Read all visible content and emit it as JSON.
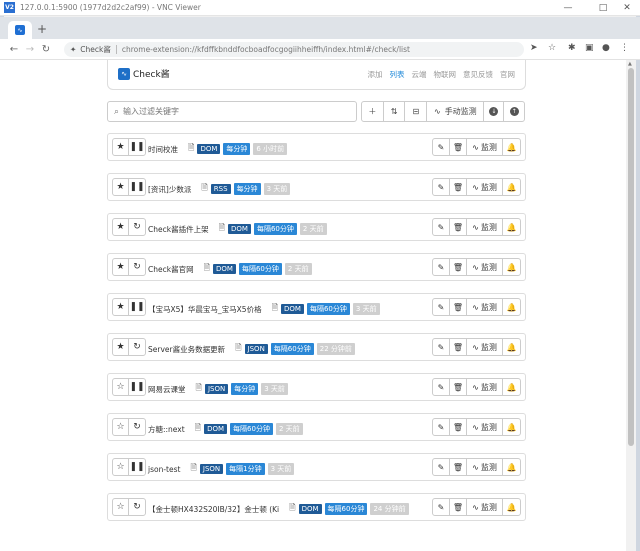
{
  "vnc": {
    "title": "127.0.0.1:5900 (1977d2d2c2af99) - VNC Viewer",
    "logo": "V2",
    "minimize": "—",
    "maximize": "□",
    "close": "✕"
  },
  "browser": {
    "new_tab": "+",
    "omnibox_ext": "Check酱",
    "url": "chrome-extension://kfdffkbnddfocboadfocgogiihheiffh/index.html#/check/list"
  },
  "app": {
    "brand": "Check酱",
    "nav": [
      "添加",
      "列表",
      "云端",
      "物联网",
      "意见反馈",
      "官网"
    ],
    "active_nav": "列表",
    "search_placeholder": "输入过滤关键字",
    "manual_monitor_label": "手动监测"
  },
  "rows": [
    {
      "name": "时间校准",
      "starred": true,
      "mode": "pause",
      "type": "DOM",
      "freq": "每分钟",
      "time": "6 小时前"
    },
    {
      "name": "[资讯]少数派",
      "starred": true,
      "mode": "pause",
      "type": "RSS",
      "freq": "每分钟",
      "time": "3 天前"
    },
    {
      "name": "Check酱插件上架",
      "starred": true,
      "mode": "sync",
      "type": "DOM",
      "freq": "每隔60分钟",
      "time": "2 天前"
    },
    {
      "name": "Check酱官网",
      "starred": true,
      "mode": "sync",
      "type": "DOM",
      "freq": "每隔60分钟",
      "time": "2 天前"
    },
    {
      "name": "【宝马X5】华晨宝马_宝马X5价格",
      "starred": true,
      "mode": "pause",
      "type": "DOM",
      "freq": "每隔60分钟",
      "time": "3 天前"
    },
    {
      "name": "Server酱业务数据更新",
      "starred": true,
      "mode": "sync",
      "type": "JSON",
      "freq": "每隔60分钟",
      "time": "22 分钟前"
    },
    {
      "name": "网易云课堂",
      "starred": false,
      "mode": "pause",
      "type": "JSON",
      "freq": "每分钟",
      "time": "3 天前"
    },
    {
      "name": "方糖::next",
      "starred": false,
      "mode": "sync",
      "type": "DOM",
      "freq": "每隔60分钟",
      "time": "2 天前"
    },
    {
      "name": "json-test",
      "starred": false,
      "mode": "pause",
      "type": "JSON",
      "freq": "每隔1分钟",
      "time": "3 天前"
    },
    {
      "name": "【金士顿HX432S20IB/32】金士顿 (Ki",
      "starred": false,
      "mode": "sync",
      "type": "DOM",
      "freq": "每隔60分钟",
      "time": "24 分钟前"
    }
  ],
  "row_action_monitor_label": "监测",
  "colors": {
    "type_badge": "#1f5a96",
    "freq_badge": "#2a87d6",
    "time_badge": "#cfcfcf",
    "accent": "#1e88d8"
  }
}
